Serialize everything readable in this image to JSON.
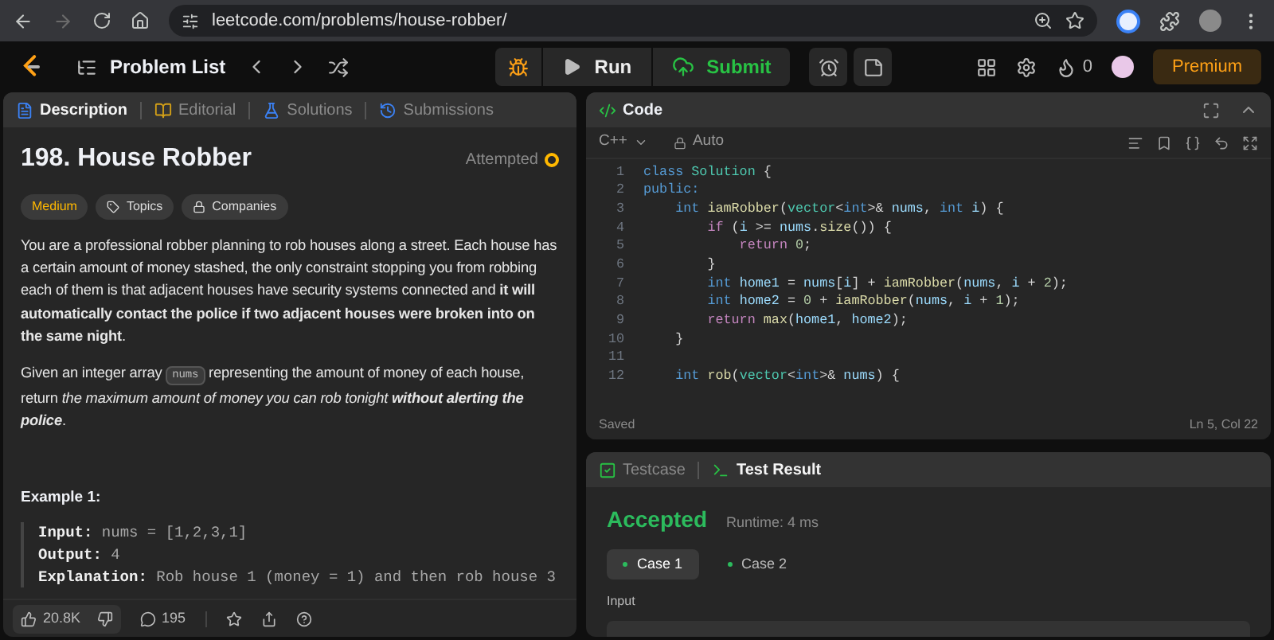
{
  "browser": {
    "url": "leetcode.com/problems/house-robber/"
  },
  "navbar": {
    "problem_list": "Problem List",
    "run": "Run",
    "submit": "Submit",
    "streak": "0",
    "premium": "Premium"
  },
  "description_panel": {
    "tabs": [
      {
        "label": "Description",
        "selected": true
      },
      {
        "label": "Editorial",
        "selected": false
      },
      {
        "label": "Solutions",
        "selected": false
      },
      {
        "label": "Submissions",
        "selected": false
      }
    ],
    "title": "198. House Robber",
    "status": "Attempted",
    "tags": [
      {
        "label": "Medium",
        "kind": "difficulty"
      },
      {
        "label": "Topics",
        "kind": "topics"
      },
      {
        "label": "Companies",
        "kind": "companies"
      }
    ],
    "paragraphs": [
      [
        {
          "kind": "text",
          "text": "You are a professional robber planning to rob houses along a street. Each house has a certain amount of money stashed, the only constraint stopping you from robbing each of them is that adjacent houses have security systems connected and **it will automatically contact the police if two adjacent houses were broken into on the same night**."
        }
      ],
      [
        {
          "kind": "text",
          "text": "Given an integer array "
        },
        {
          "kind": "code",
          "text": "nums"
        },
        {
          "kind": "text",
          "text": " representing the amount of money of each house, return *the maximum amount of money you can rob tonight* "
        },
        {
          "kind": "strong_em",
          "text": "without alerting the police"
        },
        {
          "kind": "text",
          "text": "."
        }
      ]
    ],
    "example": {
      "title": "Example 1:",
      "lines": [
        {
          "label": "Input:",
          "value": "nums = [1,2,3,1]"
        },
        {
          "label": "Output:",
          "value": "4"
        },
        {
          "label": "Explanation:",
          "value": "Rob house 1 (money = 1) and then rob house 3"
        }
      ]
    },
    "footer": {
      "likes": "20.8K",
      "comments": "195"
    }
  },
  "code_panel": {
    "title": "Code",
    "language": "C++",
    "mode": "Auto",
    "status": "Saved",
    "cursor": "Ln 5, Col 22",
    "lines": [
      {
        "number": "1",
        "tokens": [
          {
            "kind": "kw",
            "text": "class "
          },
          {
            "kind": "type",
            "text": "Solution"
          },
          {
            "kind": "plain",
            "text": " {"
          }
        ]
      },
      {
        "number": "2",
        "tokens": [
          {
            "kind": "kw",
            "text": "public:"
          }
        ]
      },
      {
        "number": "3",
        "tokens": [
          {
            "kind": "kw",
            "text": "    int "
          },
          {
            "kind": "fn",
            "text": "iamRobber"
          },
          {
            "kind": "plain",
            "text": "("
          },
          {
            "kind": "type",
            "text": "vector"
          },
          {
            "kind": "plain",
            "text": "<"
          },
          {
            "kind": "kw",
            "text": "int"
          },
          {
            "kind": "plain",
            "text": ">& "
          },
          {
            "kind": "var",
            "text": "nums"
          },
          {
            "kind": "plain",
            "text": ", "
          },
          {
            "kind": "kw",
            "text": "int "
          },
          {
            "kind": "var",
            "text": "i"
          },
          {
            "kind": "plain",
            "text": ") {"
          }
        ]
      },
      {
        "number": "4",
        "tokens": [
          {
            "kind": "ctl",
            "text": "        if "
          },
          {
            "kind": "plain",
            "text": "("
          },
          {
            "kind": "var",
            "text": "i"
          },
          {
            "kind": "plain",
            "text": " >= "
          },
          {
            "kind": "var",
            "text": "nums"
          },
          {
            "kind": "plain",
            "text": "."
          },
          {
            "kind": "fn",
            "text": "size"
          },
          {
            "kind": "plain",
            "text": "()) {"
          }
        ]
      },
      {
        "number": "5",
        "tokens": [
          {
            "kind": "ctl",
            "text": "            return "
          },
          {
            "kind": "num",
            "text": "0"
          },
          {
            "kind": "plain",
            "text": ";"
          }
        ]
      },
      {
        "number": "6",
        "tokens": [
          {
            "kind": "plain",
            "text": "        }"
          }
        ]
      },
      {
        "number": "7",
        "tokens": [
          {
            "kind": "kw",
            "text": "        int "
          },
          {
            "kind": "var",
            "text": "home1"
          },
          {
            "kind": "plain",
            "text": " = "
          },
          {
            "kind": "var",
            "text": "nums"
          },
          {
            "kind": "plain",
            "text": "["
          },
          {
            "kind": "var",
            "text": "i"
          },
          {
            "kind": "plain",
            "text": "] + "
          },
          {
            "kind": "fn",
            "text": "iamRobber"
          },
          {
            "kind": "plain",
            "text": "("
          },
          {
            "kind": "var",
            "text": "nums"
          },
          {
            "kind": "plain",
            "text": ", "
          },
          {
            "kind": "var",
            "text": "i"
          },
          {
            "kind": "plain",
            "text": " + "
          },
          {
            "kind": "num",
            "text": "2"
          },
          {
            "kind": "plain",
            "text": ");"
          }
        ]
      },
      {
        "number": "8",
        "tokens": [
          {
            "kind": "kw",
            "text": "        int "
          },
          {
            "kind": "var",
            "text": "home2"
          },
          {
            "kind": "plain",
            "text": " = "
          },
          {
            "kind": "num",
            "text": "0"
          },
          {
            "kind": "plain",
            "text": " + "
          },
          {
            "kind": "fn",
            "text": "iamRobber"
          },
          {
            "kind": "plain",
            "text": "("
          },
          {
            "kind": "var",
            "text": "nums"
          },
          {
            "kind": "plain",
            "text": ", "
          },
          {
            "kind": "var",
            "text": "i"
          },
          {
            "kind": "plain",
            "text": " + "
          },
          {
            "kind": "num",
            "text": "1"
          },
          {
            "kind": "plain",
            "text": ");"
          }
        ]
      },
      {
        "number": "9",
        "tokens": [
          {
            "kind": "ctl",
            "text": "        return "
          },
          {
            "kind": "fn",
            "text": "max"
          },
          {
            "kind": "plain",
            "text": "("
          },
          {
            "kind": "var",
            "text": "home1"
          },
          {
            "kind": "plain",
            "text": ", "
          },
          {
            "kind": "var",
            "text": "home2"
          },
          {
            "kind": "plain",
            "text": ");"
          }
        ]
      },
      {
        "number": "10",
        "tokens": [
          {
            "kind": "plain",
            "text": "    }"
          }
        ]
      },
      {
        "number": "11"
      },
      {
        "number": "12",
        "tokens": [
          {
            "kind": "kw",
            "text": "    int "
          },
          {
            "kind": "fn",
            "text": "rob"
          },
          {
            "kind": "plain",
            "text": "("
          },
          {
            "kind": "type",
            "text": "vector"
          },
          {
            "kind": "plain",
            "text": "<"
          },
          {
            "kind": "kw",
            "text": "int"
          },
          {
            "kind": "plain",
            "text": ">& "
          },
          {
            "kind": "var",
            "text": "nums"
          },
          {
            "kind": "plain",
            "text": ") {"
          }
        ]
      }
    ]
  },
  "result_panel": {
    "tabs": [
      {
        "label": "Testcase",
        "selected": false
      },
      {
        "label": "Test Result",
        "selected": true
      }
    ],
    "verdict": "Accepted",
    "runtime": "Runtime: 4 ms",
    "cases": [
      {
        "label": "Case 1",
        "selected": true
      },
      {
        "label": "Case 2",
        "selected": false
      }
    ],
    "input_label": "Input"
  }
}
